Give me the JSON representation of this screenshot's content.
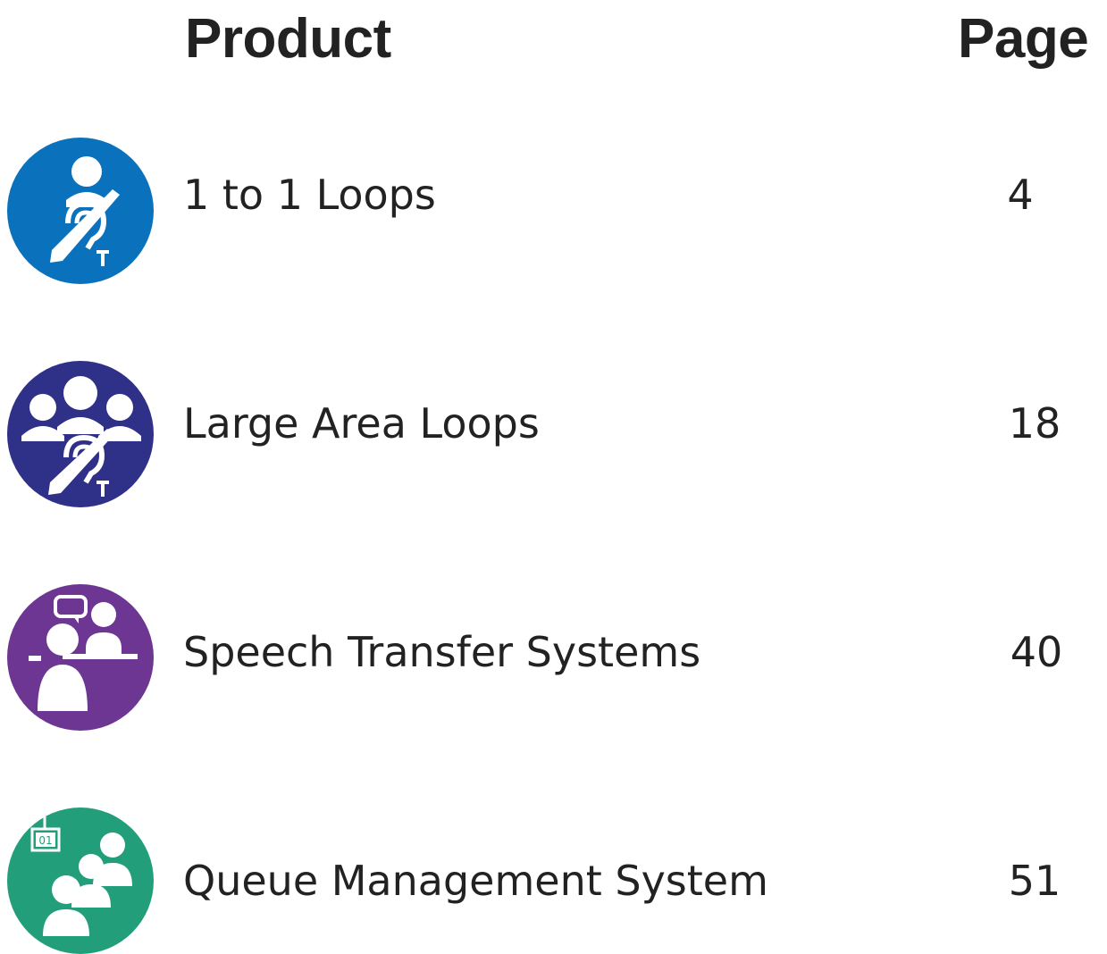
{
  "header": {
    "product_label": "Product",
    "page_label": "Page"
  },
  "rows": [
    {
      "label": "1 to 1 Loops",
      "page": "4",
      "icon": "hearing-loop-single-icon",
      "color": "#0a72bd"
    },
    {
      "label": "Large Area Loops",
      "page": "18",
      "icon": "hearing-loop-group-icon",
      "color": "#2f3088"
    },
    {
      "label": "Speech Transfer Systems",
      "page": "40",
      "icon": "speech-transfer-icon",
      "color": "#6d3693"
    },
    {
      "label": "Queue Management System",
      "page": "51",
      "icon": "queue-management-icon",
      "color": "#229e7b"
    }
  ]
}
